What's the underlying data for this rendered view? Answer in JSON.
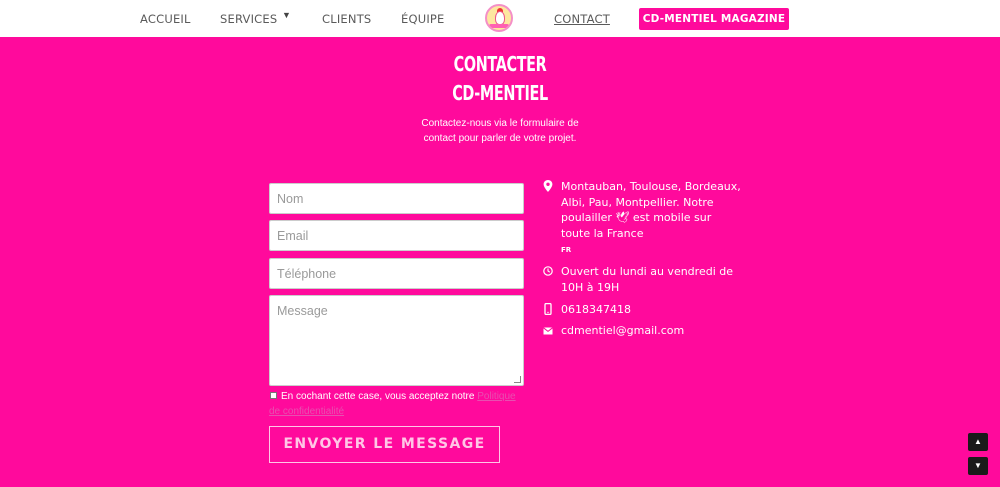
{
  "nav": {
    "items": [
      {
        "label": "ACCUEIL"
      },
      {
        "label": "SERVICES"
      },
      {
        "label": "CLIENTS"
      },
      {
        "label": "ÉQUIPE"
      },
      {
        "label": "CONTACT"
      }
    ],
    "magazine_label": "CD-MENTIEL MAGAZINE"
  },
  "header": {
    "title_line1": "CONTACTER",
    "title_line2": "CD-MENTIEL",
    "subtitle_line1": "Contactez-nous via le formulaire de",
    "subtitle_line2": "contact pour parler de votre projet."
  },
  "form": {
    "name_placeholder": "Nom",
    "email_placeholder": "Email",
    "phone_placeholder": "Téléphone",
    "message_placeholder": "Message",
    "consent_text": "En cochant cette case, vous acceptez notre ",
    "consent_link": "Politique de confidentialité",
    "submit_label": "ENVOYER LE MESSAGE"
  },
  "contact": {
    "address": "Montauban, Toulouse, Bordeaux, Albi, Pau, Montpellier. Notre poulailler 🕊 est mobile sur toute la France",
    "address_flag": "FR",
    "hours": "Ouvert du lundi au vendredi de 10H à 19H",
    "phone": "0618347418",
    "email": "cdmentiel@gmail.com"
  },
  "icons": {
    "location": "map-pin-icon",
    "hours": "clock-icon",
    "phone": "mobile-phone-icon",
    "email": "envelope-icon",
    "caret": "chevron-down-icon",
    "scroll_up": "triangle-up-icon",
    "scroll_down": "triangle-down-icon"
  },
  "colors": {
    "brand_pink": "#ff0a9c",
    "nav_background": "#ffffff",
    "nav_text": "#5a5a5a"
  }
}
